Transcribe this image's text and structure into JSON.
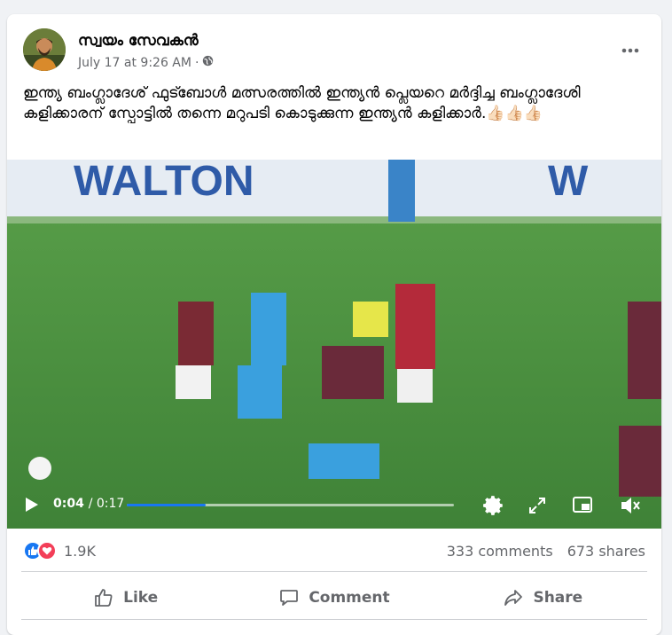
{
  "post": {
    "author": "സ്വയം സേവകൻ",
    "date": "July 17 at 9:26 AM",
    "separator": "·",
    "text": "ഇന്ത്യ ബംഗ്ലാദേശ് ഫുട്ബോൾ മത്സരത്തിൽ ഇന്ത്യൻ പ്ലെയറെ മർദ്ദിച്ച ബംഗ്ലാദേശി കളിക്കാരന് സ്പോട്ടിൽ തന്നെ മറുപടി കൊടുക്കുന്ന ഇന്ത്യൻ കളിക്കാർ.👍🏻👍🏻👍🏻"
  },
  "video": {
    "banner_text": "WALTON",
    "current_time": "0:04",
    "duration": "/ 0:17",
    "progress": 0.24
  },
  "stats": {
    "reaction_count": "1.9K",
    "comments": "333 comments",
    "shares": "673 shares"
  },
  "actions": {
    "like": "Like",
    "comment": "Comment",
    "share": "Share"
  },
  "colors": {
    "accent": "#1877f2",
    "love": "#f33e58",
    "text_secondary": "#65676b"
  }
}
